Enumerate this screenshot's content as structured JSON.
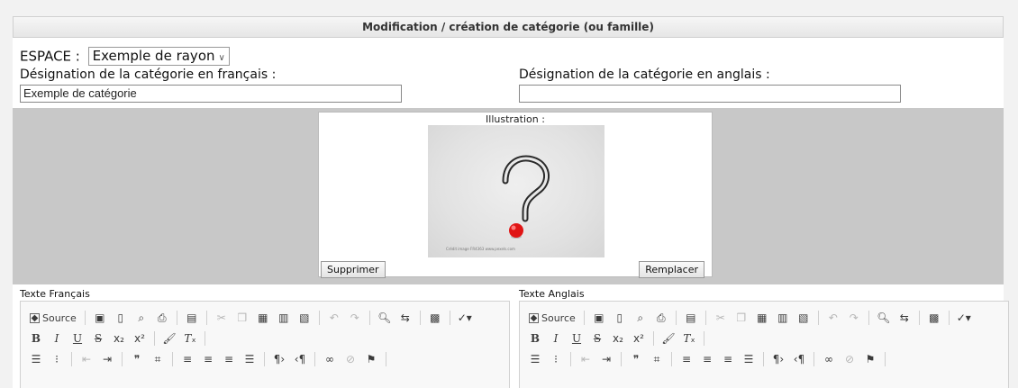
{
  "page": {
    "title": "Modification / création de catégorie (ou famille)"
  },
  "espace": {
    "label": "ESPACE :",
    "selected": "Exemple de rayon"
  },
  "designation_fr": {
    "label": "Désignation de la catégorie en français :",
    "value": "Exemple de catégorie"
  },
  "designation_en": {
    "label": "Désignation de la catégorie en anglais :",
    "value": ""
  },
  "illustration": {
    "label": "Illustration :",
    "image_glyph": "?",
    "image_credit": "Crédit image FR4363 www.pexels.com",
    "delete_label": "Supprimer",
    "replace_label": "Remplacer"
  },
  "editors": [
    {
      "label": "Texte Français"
    },
    {
      "label": "Texte Anglais"
    }
  ],
  "toolbar": {
    "source_label": "Source",
    "row1_icons": [
      "save-icon",
      "new-page-icon",
      "preview-icon",
      "print-icon",
      "templates-icon",
      "cut-icon",
      "copy-icon",
      "paste-icon",
      "paste-text-icon",
      "paste-word-icon",
      "undo-icon",
      "redo-icon",
      "find-icon",
      "replace-icon",
      "select-all-icon",
      "spellcheck-icon"
    ],
    "row2_icons": [
      "bold-icon",
      "italic-icon",
      "underline-icon",
      "strike-icon",
      "subscript-icon",
      "superscript-icon",
      "copy-format-icon",
      "remove-format-icon"
    ],
    "row3_icons": [
      "numbered-list-icon",
      "bulleted-list-icon",
      "outdent-icon",
      "indent-icon",
      "blockquote-icon",
      "div-icon",
      "align-left-icon",
      "align-center-icon",
      "align-right-icon",
      "justify-icon",
      "ltr-icon",
      "rtl-icon",
      "link-icon",
      "unlink-icon",
      "anchor-icon"
    ]
  },
  "colors": {
    "header_bg": "#e6e6e6",
    "gray_area": "#c8c8c8",
    "accent_red": "#e01515"
  }
}
